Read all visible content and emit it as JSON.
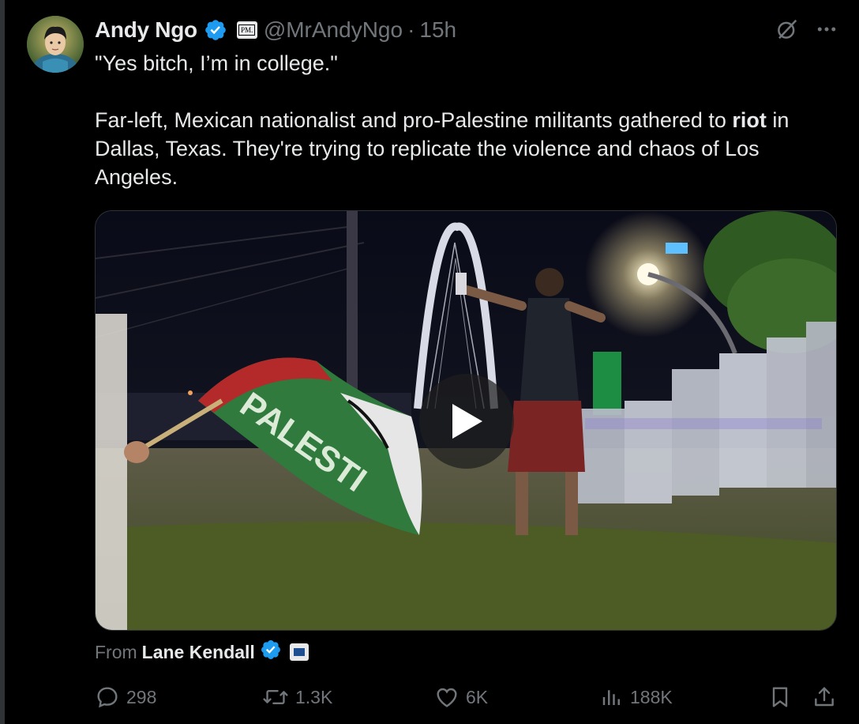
{
  "tweet": {
    "author_name": "Andy Ngo",
    "author_handle": "@MrAndyNgo",
    "separator": "·",
    "time": "15h",
    "affiliate_badge_text": "PM.",
    "line1": "\"Yes bitch, I’m in college.\"",
    "para2_part1": "Far-left, Mexican nationalist and pro-Palestine militants gathered to ",
    "para2_bold": "riot",
    "para2_part2": " in Dallas, Texas. They're trying to replicate the violence and chaos of Los Angeles.",
    "flag_text": "PALESTI"
  },
  "attribution": {
    "from_label": "From",
    "source_name": "Lane Kendall"
  },
  "actions": {
    "replies": "298",
    "reposts": "1.3K",
    "likes": "6K",
    "views": "188K"
  },
  "colors": {
    "background": "#000000",
    "text_primary": "#e7e9ea",
    "text_secondary": "#71767b",
    "verified_blue": "#1d9bf0",
    "border": "#2f3336"
  },
  "icons": [
    "grok-icon",
    "more-icon",
    "verified-badge-icon",
    "play-icon",
    "reply-icon",
    "repost-icon",
    "like-icon",
    "views-icon",
    "bookmark-icon",
    "share-icon"
  ]
}
